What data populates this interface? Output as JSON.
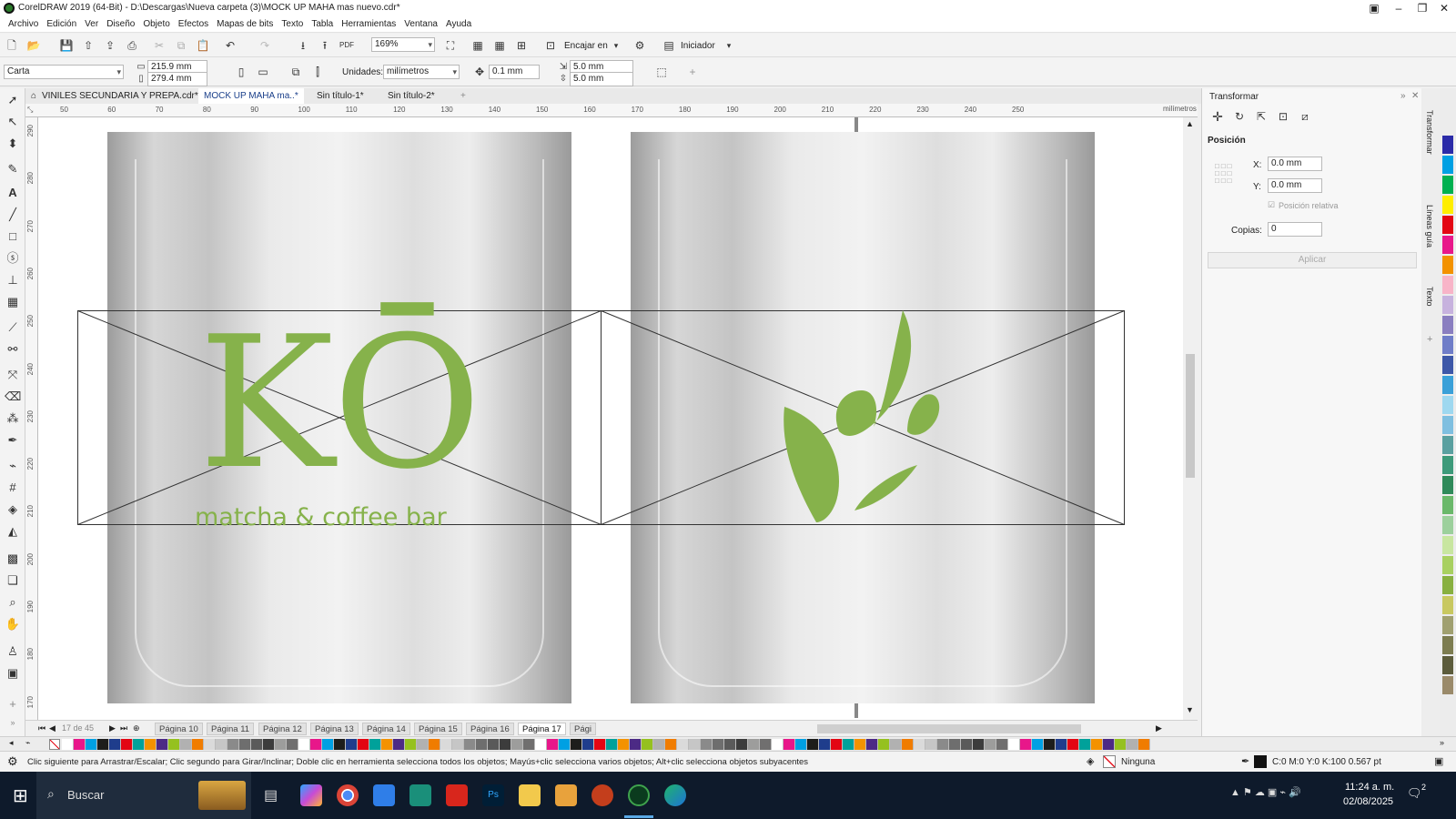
{
  "window": {
    "title": "CorelDRAW 2019 (64-Bit) - D:\\Descargas\\Nueva carpeta (3)\\MOCK UP MAHA mas nuevo.cdr*"
  },
  "menu": [
    "Archivo",
    "Edición",
    "Ver",
    "Diseño",
    "Objeto",
    "Efectos",
    "Mapas de bits",
    "Texto",
    "Tabla",
    "Herramientas",
    "Ventana",
    "Ayuda"
  ],
  "toolbar": {
    "zoom": "169%",
    "snap_label": "Encajar en",
    "launcher_label": "Iniciador"
  },
  "propbar": {
    "page_size": "Carta",
    "width": "215.9 mm",
    "height": "279.4 mm",
    "units_label": "Unidades:",
    "units": "milímetros",
    "nudge": "0.1 mm",
    "dup_x": "5.0 mm",
    "dup_y": "5.0 mm"
  },
  "tabs": [
    {
      "label": "VINILES SECUNDARIA Y PREPA.cdr*",
      "active": false
    },
    {
      "label": "MOCK UP MAHA ma..*",
      "active": true
    },
    {
      "label": "Sin título-1*",
      "active": false
    },
    {
      "label": "Sin título-2*",
      "active": false
    }
  ],
  "ruler": {
    "h_ticks": [
      "50",
      "60",
      "70",
      "80",
      "90",
      "100",
      "110",
      "120",
      "130",
      "140",
      "150",
      "160",
      "170",
      "180",
      "190",
      "200",
      "210",
      "220",
      "230",
      "240",
      "250"
    ],
    "unit": "milímetros",
    "v_ticks": [
      "290",
      "280",
      "270",
      "260",
      "250",
      "240",
      "230",
      "220",
      "210",
      "200",
      "190",
      "180",
      "170"
    ]
  },
  "canvas": {
    "logo_text": "KŌ",
    "tagline": "matcha & coffee bar",
    "logo_color": "#86b24b"
  },
  "pages": {
    "counter": "17 de 45",
    "tabs": [
      "Página 10",
      "Página 11",
      "Página 12",
      "Página 13",
      "Página 14",
      "Página 15",
      "Página 16",
      "Página 17",
      "Pági"
    ],
    "active": "Página 17"
  },
  "docker": {
    "title": "Transformar",
    "section": "Posición",
    "x_label": "X:",
    "x_value": "0.0 mm",
    "y_label": "Y:",
    "y_value": "0.0 mm",
    "relative_label": "Posición relativa",
    "copies_label": "Copias:",
    "copies_value": "0",
    "apply_label": "Aplicar",
    "side_tabs": [
      "Transformar",
      "Líneas guía",
      "Texto"
    ]
  },
  "status": {
    "hint": "Clic siguiente para Arrastrar/Escalar; Clic segundo para Girar/Inclinar; Doble clic en herramienta selecciona todos los objetos; Mayús+clic selecciona varios objetos; Alt+clic selecciona objetos subyacentes",
    "fill": "Ninguna",
    "outline": "C:0 M:0 Y:0 K:100  0.567 pt"
  },
  "taskbar": {
    "search": "Buscar",
    "time": "11:24 a. m.",
    "date": "02/08/2025",
    "notif": "2"
  },
  "palette_colors": [
    "#ffffff",
    "#e8178a",
    "#00a0e3",
    "#1d1d1b",
    "#1f3d8c",
    "#e30613",
    "#00a19a",
    "#f39200",
    "#4c2a85",
    "#95c11f",
    "#b1b1b1",
    "#f07c00",
    "#dadada",
    "#c6c6c6",
    "#8a8a8a",
    "#6e6e6e",
    "#5a5a5a",
    "#3c3c3c",
    "#9d9d9c",
    "#706f6f"
  ],
  "vpalette_colors": [
    "#2b2ba8",
    "#00a0e3",
    "#00b050",
    "#ffee00",
    "#e30613",
    "#e8178a",
    "#f39200",
    "#f8b4c8",
    "#c7b2de",
    "#8a7ec0",
    "#6f7dc8",
    "#3d57a8",
    "#3aa0d8",
    "#9ed8f0",
    "#7fbfe0",
    "#5aa0a0",
    "#3d9a7a",
    "#2f8a5a",
    "#6ab86a",
    "#9cd09c",
    "#c8e6a0",
    "#a8d060",
    "#88b040",
    "#c8c860",
    "#a0a070",
    "#7c7c50",
    "#5c5c3c",
    "#9a8a6a"
  ]
}
